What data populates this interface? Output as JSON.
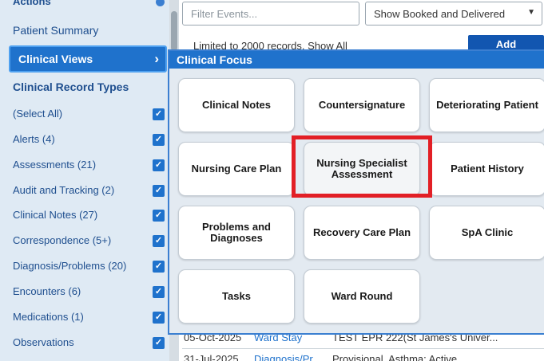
{
  "sidebar": {
    "top_partial_label": "Actions",
    "patient_summary": "Patient Summary",
    "clinical_views": "Clinical Views",
    "clinical_views_chevron": "›",
    "record_types_heading": "Clinical Record Types",
    "check_mark": "✓",
    "record_types": [
      {
        "label": "(Select All)",
        "checked": true
      },
      {
        "label": "Alerts (4)",
        "checked": true
      },
      {
        "label": "Assessments (21)",
        "checked": true
      },
      {
        "label": "Audit and Tracking (2)",
        "checked": true
      },
      {
        "label": "Clinical Notes (27)",
        "checked": true
      },
      {
        "label": "Correspondence (5+)",
        "checked": true
      },
      {
        "label": "Diagnosis/Problems (20)",
        "checked": true
      },
      {
        "label": "Encounters (6)",
        "checked": true
      },
      {
        "label": "Medications (1)",
        "checked": true
      },
      {
        "label": "Observations",
        "checked": true
      }
    ]
  },
  "toolbar": {
    "filter_placeholder": "Filter Events...",
    "show_select_value": "Show Booked and Delivered",
    "show_select_caret": "▼",
    "limited_text": "Limited to 2000 records. Show All",
    "add_label": "Add"
  },
  "flyout": {
    "title": "Clinical Focus",
    "tiles": [
      "Clinical Notes",
      "Countersignature",
      "Deteriorating Patient",
      "Nursing Care Plan",
      "Nursing Specialist Assessment",
      "Patient History",
      "Problems and Diagnoses",
      "Recovery Care Plan",
      "SpA Clinic",
      "Tasks",
      "Ward Round"
    ],
    "highlighted_tile": "Nursing Specialist Assessment"
  },
  "background_rows": [
    {
      "date": "05-Oct-2025",
      "type": "Ward Stay",
      "value": "TEST EPR 222(St James's Univer..."
    },
    {
      "date": "31-Jul-2025",
      "type": "Diagnosis/Pr...",
      "value": "Provisional, Asthma: Active"
    }
  ],
  "colors": {
    "accent": "#1f72cc",
    "highlight": "#e21f26",
    "sidebar_bg": "#dfeaf4"
  }
}
